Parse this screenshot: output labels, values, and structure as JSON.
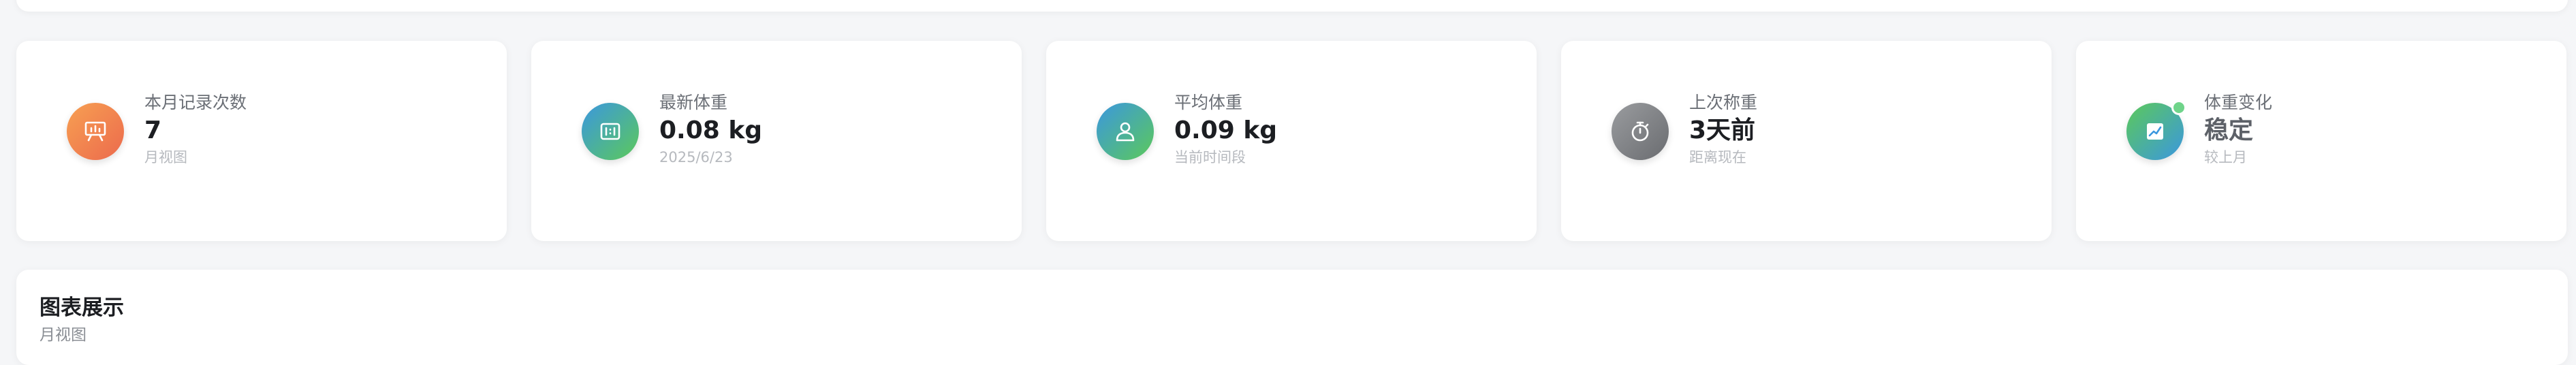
{
  "stats": [
    {
      "label": "本月记录次数",
      "value": "7",
      "sub": "月视图",
      "icon": "presentation-board-icon",
      "color": "#ec6a4d"
    },
    {
      "label": "最新体重",
      "value": "0.08 kg",
      "sub": "2025/6/23",
      "icon": "scale-display-icon",
      "color": "#3b97df"
    },
    {
      "label": "平均体重",
      "value": "0.09 kg",
      "sub": "当前时间段",
      "icon": "user-icon",
      "color": "#3b97df"
    },
    {
      "label": "上次称重",
      "value": "3天前",
      "sub": "距离现在",
      "icon": "stopwatch-icon",
      "color": "#6a6c70"
    },
    {
      "label": "体重变化",
      "value": "稳定",
      "sub": "较上月",
      "icon": "trend-chart-icon",
      "color": "#5cc95a"
    }
  ],
  "chart_section": {
    "title": "图表展示",
    "subtitle": "月视图"
  }
}
